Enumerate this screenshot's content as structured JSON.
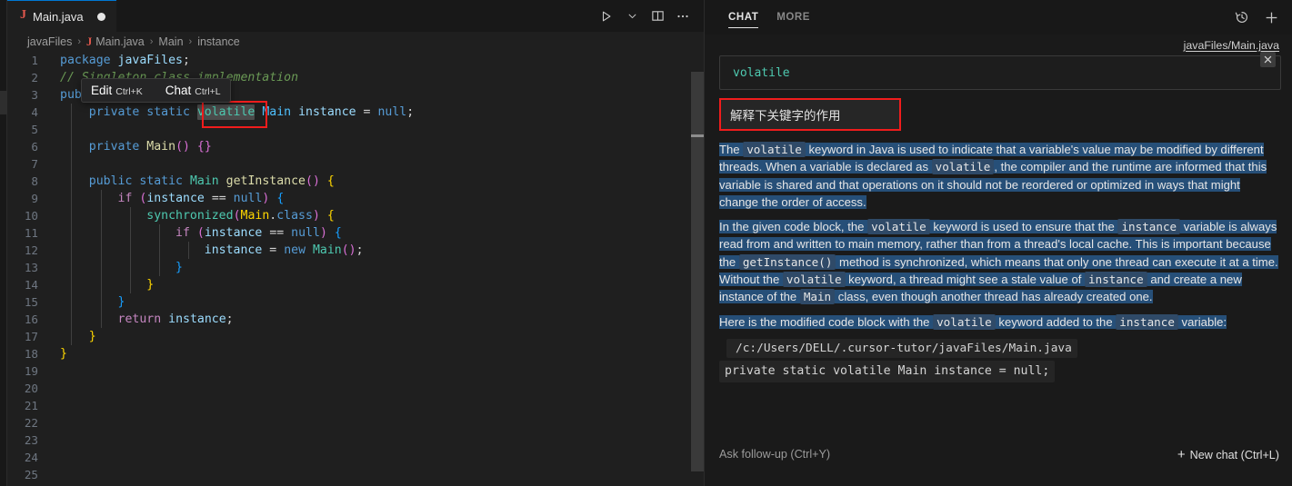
{
  "editor": {
    "tab": {
      "filename": "Main.java",
      "icon": "java-icon",
      "dirty_indicator": "●"
    },
    "toolbar": {
      "run_label": "run-icon",
      "run_chevron_label": "chevron-down-icon",
      "split_label": "split-editor-icon",
      "more_label": "more-actions-icon"
    },
    "breadcrumb": [
      "javaFiles",
      "Main.java",
      "Main",
      "instance"
    ],
    "breadcrumb_separator": "›",
    "inline_widget": {
      "edit_label": "Edit",
      "edit_key": "Ctrl+K",
      "chat_label": "Chat",
      "chat_key": "Ctrl+L"
    },
    "lines": [
      {
        "n": "1",
        "text": "package javaFiles;"
      },
      {
        "n": "2",
        "text": "// Singleton class implementation"
      },
      {
        "n": "3",
        "text": "public class Main {"
      },
      {
        "n": "4",
        "text": "    private static volatile Main instance = null;"
      },
      {
        "n": "5",
        "text": ""
      },
      {
        "n": "6",
        "text": "    private Main() {}"
      },
      {
        "n": "7",
        "text": ""
      },
      {
        "n": "8",
        "text": "    public static Main getInstance() {"
      },
      {
        "n": "9",
        "text": "        if (instance == null) {"
      },
      {
        "n": "10",
        "text": "            synchronized(Main.class) {"
      },
      {
        "n": "11",
        "text": "                if (instance == null) {"
      },
      {
        "n": "12",
        "text": "                    instance = new Main();"
      },
      {
        "n": "13",
        "text": "                }"
      },
      {
        "n": "14",
        "text": "            }"
      },
      {
        "n": "15",
        "text": "        }"
      },
      {
        "n": "16",
        "text": "        return instance;"
      },
      {
        "n": "17",
        "text": "    }"
      },
      {
        "n": "18",
        "text": "}"
      },
      {
        "n": "19",
        "text": ""
      },
      {
        "n": "20",
        "text": ""
      },
      {
        "n": "21",
        "text": ""
      },
      {
        "n": "22",
        "text": ""
      },
      {
        "n": "23",
        "text": ""
      },
      {
        "n": "24",
        "text": ""
      },
      {
        "n": "25",
        "text": ""
      }
    ],
    "highlighted_word": "volatile",
    "annotation_color": "#f01c1c"
  },
  "chat": {
    "tabs": [
      {
        "label": "CHAT",
        "active": true
      },
      {
        "label": "MORE",
        "active": false
      }
    ],
    "actions": {
      "history_label": "history-icon",
      "new_label": "plus-icon"
    },
    "context_file": "javaFiles/Main.java",
    "prompt_value": "volatile",
    "prompt_close_label": "✕",
    "user_message": "解释下关键字的作用",
    "answer": {
      "p1_a": "The ",
      "p1_code1": "volatile",
      "p1_b": " keyword in Java is used to indicate that a variable's value may be modified by different threads. When a variable is declared as ",
      "p1_code2": "volatile",
      "p1_c": ", the compiler and the runtime are informed that this variable is shared and that operations on it should not be reordered or optimized in ways that might change the order of access.",
      "p2_a": "In the given code block, the ",
      "p2_code1": "volatile",
      "p2_b": " keyword is used to ensure that the ",
      "p2_code2": "instance",
      "p2_c": " variable is always read from and written to main memory, rather than from a thread's local cache. This is important because the ",
      "p2_code3": "getInstance()",
      "p2_d": " method is synchronized, which means that only one thread can execute it at a time. Without the ",
      "p2_code4": "volatile",
      "p2_e": " keyword, a thread might see a stale value of ",
      "p2_code5": "instance",
      "p2_f": " and create a new instance of the ",
      "p2_code6": "Main",
      "p2_g": " class, even though another thread has already created one.",
      "p3_a": "Here is the modified code block with the ",
      "p3_code1": "volatile",
      "p3_b": " keyword added to the ",
      "p3_code2": "instance",
      "p3_c": " variable:"
    },
    "code_block": {
      "path": "/c:/Users/DELL/.cursor-tutor/javaFiles/Main.java",
      "line": "private static volatile Main instance = null;"
    },
    "footer": {
      "follow_up": "Ask follow-up (Ctrl+Y)",
      "new_chat": "New chat (Ctrl+L)",
      "plus": "+"
    }
  },
  "theme": {
    "accent": "#0078d4",
    "selection": "#264f78",
    "annotation_red": "#f01c1c",
    "editor_bg": "#1f1f1f",
    "panel_bg": "#1a1a1a"
  }
}
